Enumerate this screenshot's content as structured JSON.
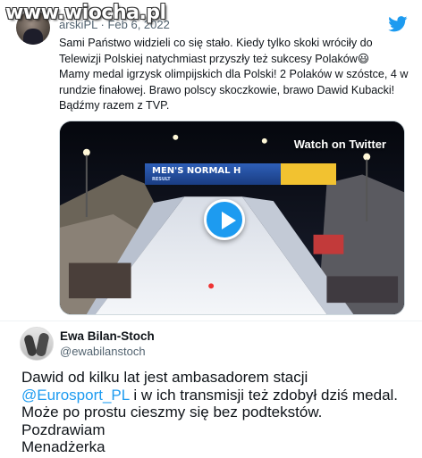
{
  "watermark": {
    "text": "www.wiocha.pl"
  },
  "quoted_tweet": {
    "author_partial": "arskiPL",
    "separator": "·",
    "date": "Feb 6, 2022",
    "text_lines": [
      "Sami Państwo widzieli co się stało. Kiedy tylko skoki wróciły do",
      "Telewizji Polskiej natychmiast przyszły też sukcesy Polaków😃",
      "Mamy medal igrzysk olimpijskich dla Polski! 2 Polaków w szóstce, 4 w",
      "rundzie finałowej. Brawo polscy skoczkowie, brawo Dawid Kubacki!",
      "Bądźmy razem z TVP."
    ],
    "video": {
      "watch_label": "Watch on Twitter",
      "banner_title": "MEN'S NORMAL H",
      "banner_sub": "RESULT"
    }
  },
  "reply": {
    "name": "Ewa Bilan-Stoch",
    "handle": "@ewabilanstoch",
    "text_before_mention": "Dawid od kilku lat jest ambasadorem stacji ",
    "mention": "@Eurosport_PL",
    "text_after_mention": "i w ich transmisji też zdobył dziś medal. Może po prostu cieszmy się bez podtekstów.",
    "sign_off_1": "Pozdrawiam",
    "sign_off_2": "Menadżerka"
  },
  "colors": {
    "accent": "#1d9bf0",
    "secondary_text": "#536471",
    "text": "#0f1419"
  },
  "icons": [
    "twitter-bird-icon",
    "play-icon"
  ]
}
